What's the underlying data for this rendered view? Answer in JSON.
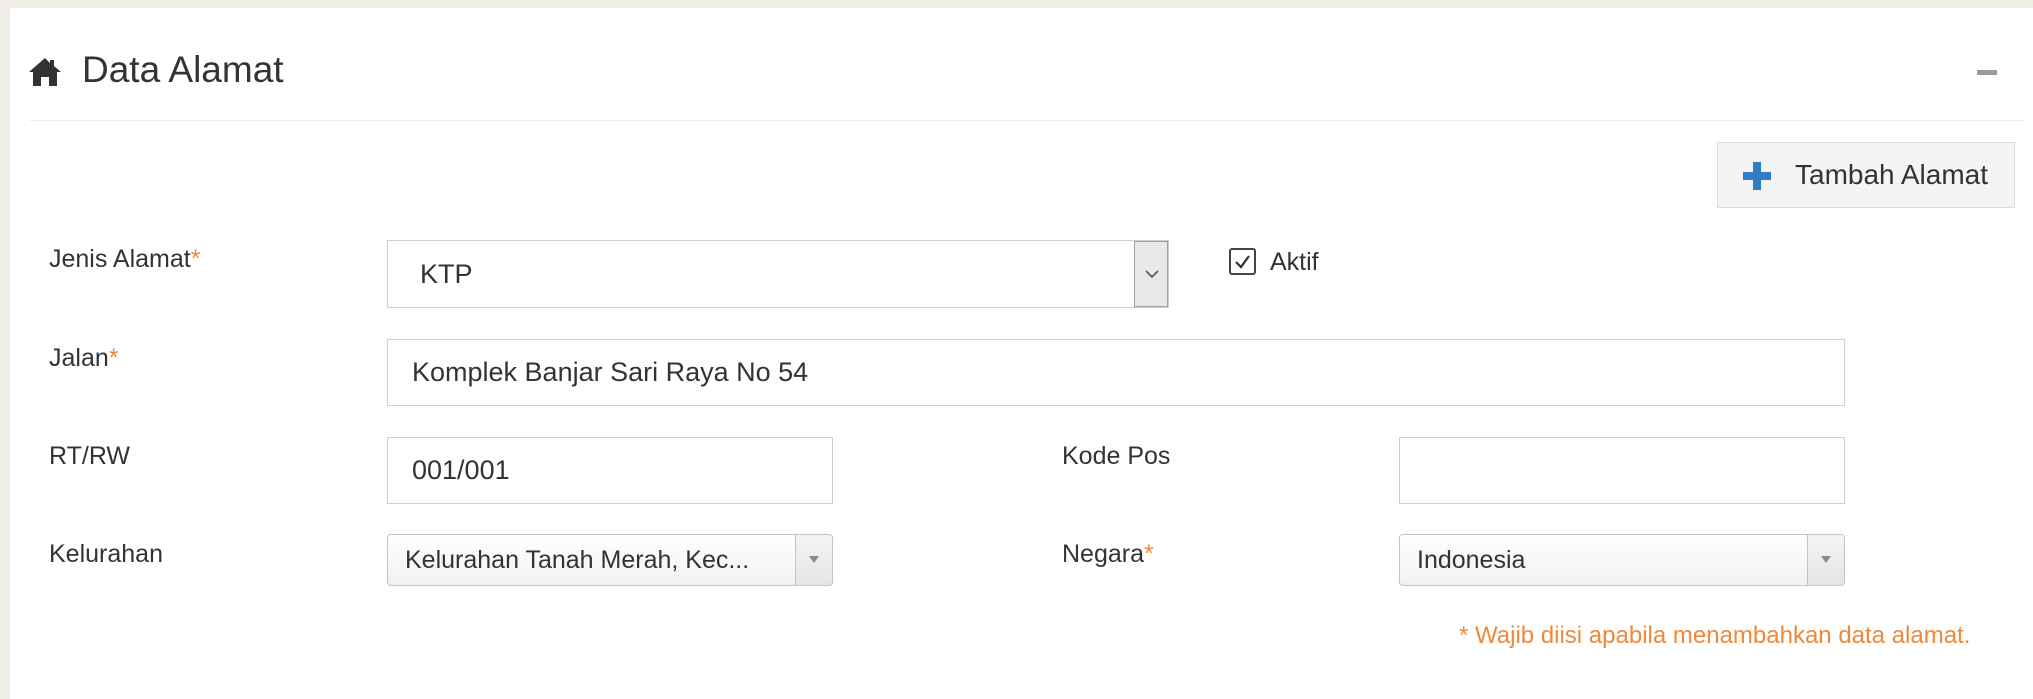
{
  "panel": {
    "title": "Data Alamat",
    "title_icon": "home-icon",
    "collapse_icon": "minus-icon"
  },
  "toolbar": {
    "add_label": "Tambah Alamat",
    "add_icon": "plus-icon"
  },
  "form": {
    "jenis_alamat": {
      "label": "Jenis Alamat",
      "required_mark": "*",
      "value": "KTP"
    },
    "aktif": {
      "label": "Aktif",
      "checked": true
    },
    "jalan": {
      "label": "Jalan",
      "required_mark": "*",
      "value": "Komplek Banjar Sari Raya No 54"
    },
    "rt_rw": {
      "label": "RT/RW",
      "value": "001/001"
    },
    "kode_pos": {
      "label": "Kode Pos",
      "value": ""
    },
    "kelurahan": {
      "label": "Kelurahan",
      "value": "Kelurahan Tanah Merah, Kec..."
    },
    "negara": {
      "label": "Negara",
      "required_mark": "*",
      "value": "Indonesia"
    }
  },
  "footnote": "* Wajib diisi apabila menambahkan data alamat.",
  "colors": {
    "accent_blue": "#2f7dc5",
    "required_orange": "#f0883a",
    "page_background": "#efede6"
  }
}
